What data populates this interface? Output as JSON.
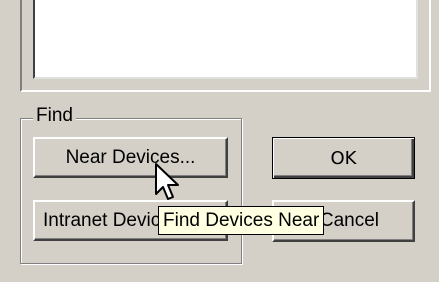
{
  "find_group": {
    "label": "Find"
  },
  "buttons": {
    "near_devices": "Near Devices...",
    "intranet_devices": "Intranet Devices...",
    "ok": "OK",
    "cancel": "Cancel"
  },
  "tooltip": {
    "text": "Find Devices Near"
  },
  "icons": {
    "cursor": "arrow-pointer-icon"
  },
  "colors": {
    "face": "#d4d0c8",
    "tooltip_bg": "#ffffe1"
  }
}
